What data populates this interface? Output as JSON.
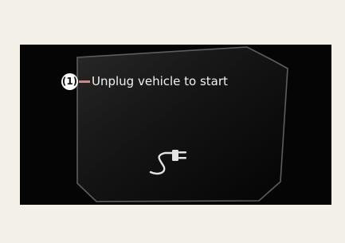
{
  "display": {
    "callout_number": "(1)",
    "message": "Unplug vehicle to start",
    "icon": "charging-plug-icon",
    "colors": {
      "page_background": "#f3f0e7",
      "screen_background": "#050505",
      "text": "#f1f1f1",
      "callout_line": "#c98a88",
      "icon": "#e2e2e2"
    }
  }
}
